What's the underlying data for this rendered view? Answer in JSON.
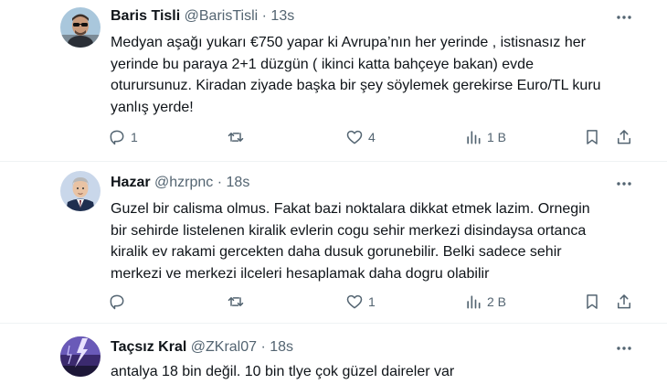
{
  "tweets": [
    {
      "name": "Baris Tisli",
      "handle": "@BarisTisli",
      "dot": "·",
      "time": "13s",
      "avatar_icon": "profile-photo-man-sunglasses",
      "lines": [
        "Medyan aşağı yukarı €750 yapar ki Avrupa’nın her yerinde , istisnasız her",
        "yerinde bu paraya 2+1 düzgün ( ikinci katta bahçeye bakan) evde",
        "oturursunuz. Kiradan ziyade başka bir şey söylemek gerekirse Euro/TL kuru",
        "yanlış yerde!"
      ],
      "reply_count": "1",
      "retweet_count": "",
      "like_count": "4",
      "view_count": "1 B"
    },
    {
      "name": "Hazar",
      "handle": "@hzrpnc",
      "dot": "·",
      "time": "18s",
      "avatar_icon": "profile-illustration-man-suit",
      "lines": [
        "Guzel bir calisma olmus. Fakat bazi noktalara dikkat etmek lazim. Ornegin",
        "bir sehirde listelenen kiralik evlerin cogu sehir merkezi disindaysa ortanca",
        "kiralik ev rakami gercekten daha dusuk gorunebilir. Belki sadece sehir",
        "merkezi ve merkezi ilceleri hesaplamak daha dogru olabilir"
      ],
      "reply_count": "",
      "retweet_count": "",
      "like_count": "1",
      "view_count": "2 B"
    },
    {
      "name": "Taçsız Kral",
      "handle": "@ZKral07",
      "dot": "·",
      "time": "18s",
      "avatar_icon": "profile-photo-lightning",
      "lines": [
        "antalya 18 bin değil. 10 bin tlye çok güzel daireler var"
      ]
    }
  ],
  "colors": {
    "text_primary": "#0f1419",
    "text_secondary": "#536471",
    "divider": "#eff3f4"
  }
}
